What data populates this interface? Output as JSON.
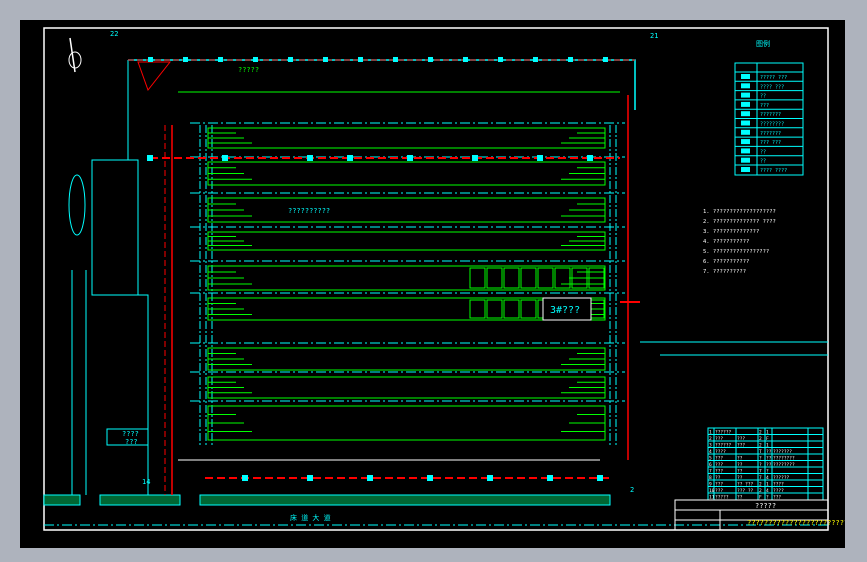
{
  "colors": {
    "background": "#000000",
    "frame": "#ffffff",
    "outline": "#00ffff",
    "bays": "#00ff00",
    "pipe": "#ff0000",
    "annotation": "#ffffff",
    "title_strip": "#ffff00",
    "viewport_border": "#aeb3bd"
  },
  "labels": {
    "axis_22": "22",
    "axis_21": "21",
    "axis_14": "14",
    "top_note": "?????",
    "center_note": "??????????",
    "station_3": "3#???",
    "left_box_line1": "????",
    "left_box_line2": "???",
    "road": "床 道 大 道",
    "bottom_mark": "2",
    "legend_title": "图例"
  },
  "legend": {
    "header": [
      "图",
      "例"
    ],
    "rows": [
      "????? ???",
      "???? ???",
      "??",
      "???",
      "???????",
      "????????",
      "???????",
      "??? ???",
      "??",
      "??",
      "???? ????"
    ]
  },
  "notes": [
    "1. ???????????????????",
    "2. ?????????????? ????",
    "3. ??????????????",
    "4. ???????????",
    "5. ?????????????????",
    "6. ???????????",
    "7. ??????????"
  ],
  "table": {
    "rows": [
      [
        "1",
        "??????",
        "",
        "2",
        "1",
        ""
      ],
      [
        "2",
        "???",
        "???",
        "2",
        "F",
        ""
      ],
      [
        "3",
        "??????",
        "???",
        "2",
        "1",
        ""
      ],
      [
        "4",
        "????",
        "",
        "T",
        "??",
        "???????"
      ],
      [
        "5",
        "???",
        "??",
        "?",
        "??",
        "????????"
      ],
      [
        "6",
        "???",
        "??",
        "?",
        "??",
        "????????"
      ],
      [
        "7",
        "???",
        "??",
        "7",
        "?",
        ""
      ],
      [
        "8",
        "??",
        "??",
        "7",
        "4",
        "??????"
      ],
      [
        "9",
        "???",
        "?? ???",
        "2",
        "1",
        "????"
      ],
      [
        "10",
        "???",
        "??? ??",
        "2",
        "4",
        "????"
      ],
      [
        "11",
        "?????",
        "??",
        "F",
        "?",
        "???"
      ]
    ]
  },
  "title_block": {
    "project": "????????????????????????",
    "name": "?????"
  }
}
